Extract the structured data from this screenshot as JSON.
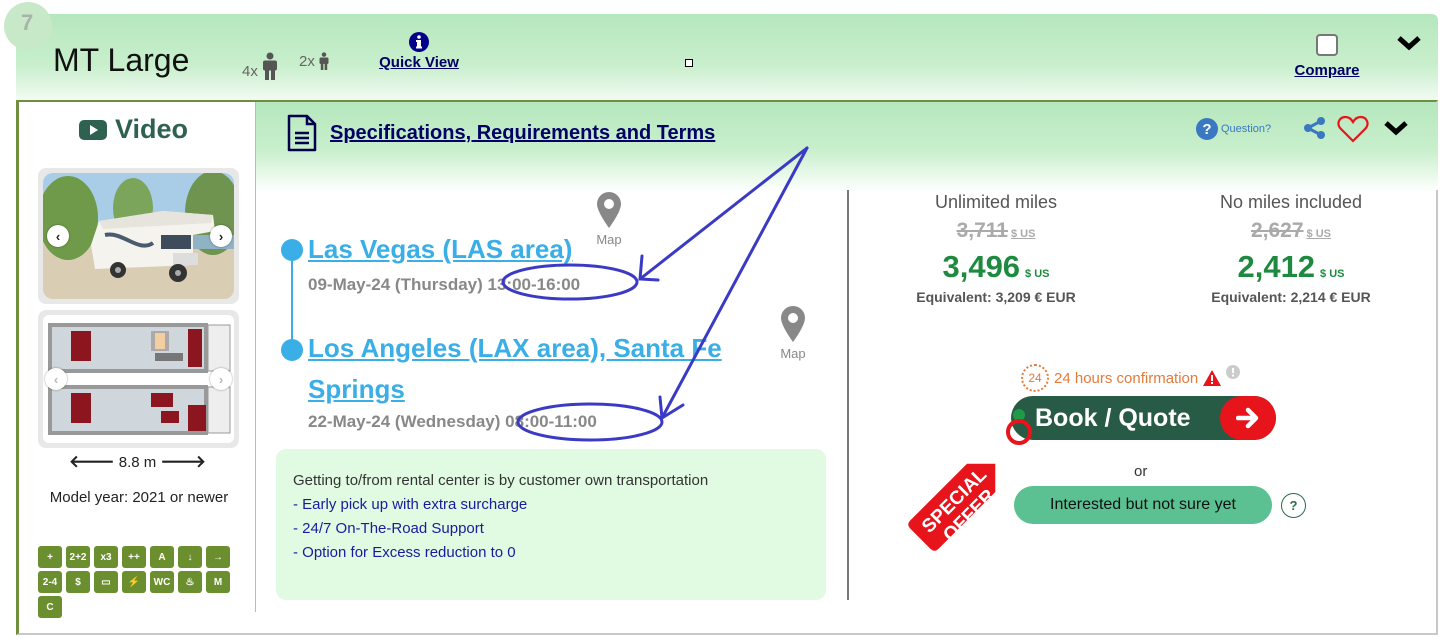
{
  "rank": "7",
  "header": {
    "title": "MT Large",
    "adults": "4x",
    "children": "2x",
    "quick_view_label": "Quick View",
    "compare_label": "Compare",
    "compare_checked": false
  },
  "media": {
    "video_label": "Video",
    "length": "8.8 m",
    "model_year": "Model year: 2021 or newer",
    "feature_icons": [
      "child-seat-icon",
      "2+2-icon",
      "x3-icon",
      "family-plus-icon",
      "automatic-icon",
      "awning-icon",
      "slide-out-icon",
      "2-4-beds-icon",
      "money-icon",
      "tv-icon",
      "electricity-icon",
      "wc-icon",
      "shower-icon",
      "microwave-icon",
      "c-class-icon"
    ],
    "feature_labels": [
      "+",
      "2+2",
      "x3",
      "++",
      "A",
      "↓",
      "→",
      "2-4",
      "$",
      "▭",
      "⚡",
      "WC",
      "♨",
      "M",
      "C"
    ]
  },
  "specs": {
    "link_label": "Specifications, Requirements and Terms",
    "question_label": "Question?"
  },
  "route": {
    "pickup": {
      "location": "Las Vegas (LAS area)",
      "date": "09-May-24 (Thursday)",
      "time": "13:00-16:00",
      "map_label": "Map"
    },
    "dropoff": {
      "location": "Los Angeles (LAX area), Santa Fe Springs",
      "date": "22-May-24 (Wednesday)",
      "time": "08:00-11:00",
      "map_label": "Map"
    }
  },
  "info": {
    "line1": "Getting to/from rental center is by customer own transportation",
    "bullets": [
      "- Early pick up with extra surcharge",
      "- 24/7 On-The-Road Support",
      "- Option for Excess reduction to 0"
    ]
  },
  "pricing": [
    {
      "heading": "Unlimited miles",
      "old_price": "3,711",
      "currency": "$ US",
      "price": "3,496",
      "equivalent": "Equivalent: 3,209 € EUR"
    },
    {
      "heading": "No miles included",
      "old_price": "2,627",
      "currency": "$ US",
      "price": "2,412",
      "equivalent": "Equivalent: 2,214 € EUR"
    }
  ],
  "booking": {
    "confirm_badge": "24",
    "confirm_text": "24 hours confirmation",
    "book_label": "Book / Quote",
    "or_label": "or",
    "interested_label": "Interested but not sure yet",
    "help_label": "?",
    "special_line1": "SPECIAL",
    "special_line2": "OFFER"
  },
  "colors": {
    "header_green": "#b5e7bd",
    "link_blue": "#3aaee6",
    "price_green": "#1e8a40",
    "book_dark_green": "#275b45",
    "offer_red": "#e8141c",
    "annotation_blue": "#3a3ac4"
  }
}
